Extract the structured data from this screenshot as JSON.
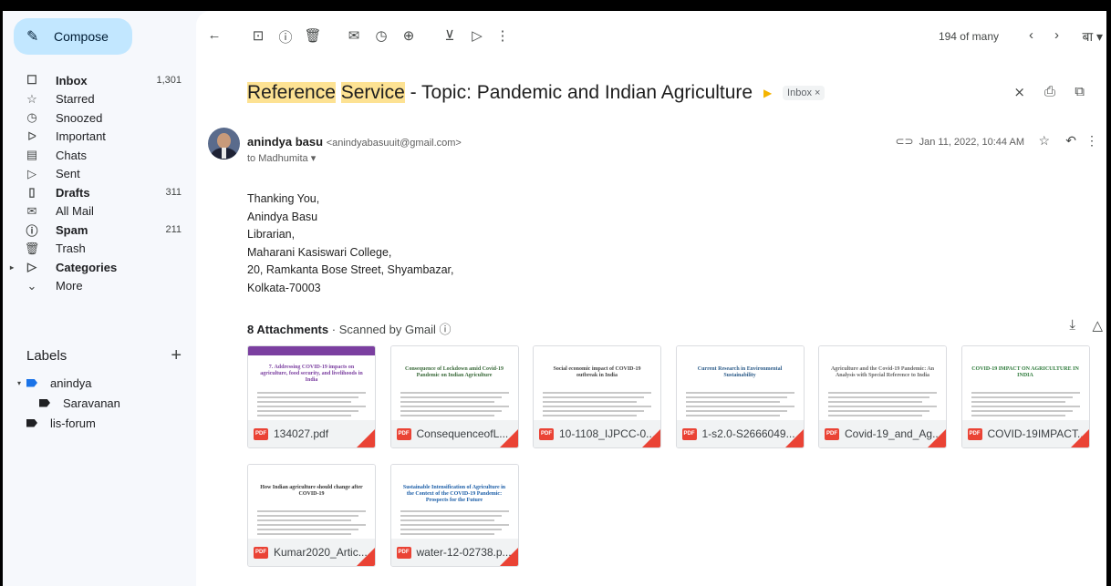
{
  "sidebar": {
    "compose_label": "Compose",
    "items": [
      {
        "label": "Inbox",
        "count": "1,301",
        "icon": "inbox-icon",
        "glyph": "☐",
        "bold": true
      },
      {
        "label": "Starred",
        "count": "",
        "icon": "star-icon",
        "glyph": "☆",
        "bold": false
      },
      {
        "label": "Snoozed",
        "count": "",
        "icon": "clock-icon",
        "glyph": "◷",
        "bold": false
      },
      {
        "label": "Important",
        "count": "",
        "icon": "important-icon",
        "glyph": "ᐅ",
        "bold": false
      },
      {
        "label": "Chats",
        "count": "",
        "icon": "chat-icon",
        "glyph": "▤",
        "bold": false
      },
      {
        "label": "Sent",
        "count": "",
        "icon": "send-icon",
        "glyph": "▷",
        "bold": false
      },
      {
        "label": "Drafts",
        "count": "311",
        "icon": "draft-icon",
        "glyph": "▯",
        "bold": true
      },
      {
        "label": "All Mail",
        "count": "",
        "icon": "all-mail-icon",
        "glyph": "✉",
        "bold": false
      },
      {
        "label": "Spam",
        "count": "211",
        "icon": "spam-icon",
        "glyph": "ⓘ",
        "bold": true
      },
      {
        "label": "Trash",
        "count": "",
        "icon": "trash-icon",
        "glyph": "🗑",
        "bold": false
      },
      {
        "label": "Categories",
        "count": "",
        "icon": "label-icon",
        "glyph": "▷",
        "bold": true
      },
      {
        "label": "More",
        "count": "",
        "icon": "chevron-down-icon",
        "glyph": "⌄",
        "bold": false
      }
    ],
    "labels_heading": "Labels",
    "labels": [
      {
        "label": "anindya",
        "color": "#1a73e8",
        "indent": false
      },
      {
        "label": "Saravanan",
        "color": "#202124",
        "indent": true
      },
      {
        "label": "lis-forum",
        "color": "#202124",
        "indent": false
      }
    ]
  },
  "toolbar": {
    "pager_text": "194 of many",
    "language": "बा ▾"
  },
  "email": {
    "subject_hl1": "Reference",
    "subject_hl2": "Service",
    "subject_rest": " - Topic: Pandemic and Indian Agriculture",
    "chip": "Inbox ×",
    "sender_name": "anindya basu",
    "sender_email": "<anindyabasuuit@gmail.com>",
    "to_line": "to Madhumita ▾",
    "date": "Jan 11, 2022, 10:44 AM",
    "body_lines": [
      "Thanking You,",
      "Anindya Basu",
      "Librarian,",
      "Maharani Kasiswari College,",
      "20, Ramkanta Bose Street, Shyambazar,",
      "Kolkata-70003"
    ]
  },
  "attachments": {
    "count_label": "8 Attachments",
    "scanned_label": "Scanned by Gmail ⓘ",
    "files": [
      {
        "name": "134027.pdf",
        "title": "7. Addressing COVID-19 impacts on agriculture, food security, and livelihoods in India"
      },
      {
        "name": "ConsequenceofL...",
        "title": "Consequence of Lockdown amid Covid-19 Pandemic on Indian Agriculture"
      },
      {
        "name": "10-1108_IJPCC-0...",
        "title": "Social economic impact of COVID-19 outbreak in India"
      },
      {
        "name": "1-s2.0-S2666049...",
        "title": "Current Research in Environmental Sustainability"
      },
      {
        "name": "Covid-19_and_Ag...",
        "title": "Agriculture and the Covid-19 Pandemic: An Analysis with Special Reference to India"
      },
      {
        "name": "COVID-19IMPACT...",
        "title": "COVID-19 IMPACT ON AGRICULTURE IN INDIA"
      },
      {
        "name": "Kumar2020_Artic...",
        "title": "How Indian agriculture should change after COVID-19"
      },
      {
        "name": "water-12-02738.p...",
        "title": "Sustainable Intensification of Agriculture in the Context of the COVID-19 Pandemic: Prospects for the Future"
      }
    ]
  },
  "colors": {
    "compose_bg": "#c2e7ff",
    "highlight": "#fde293",
    "pdf_red": "#ea4335",
    "important_yellow": "#f4b400"
  }
}
